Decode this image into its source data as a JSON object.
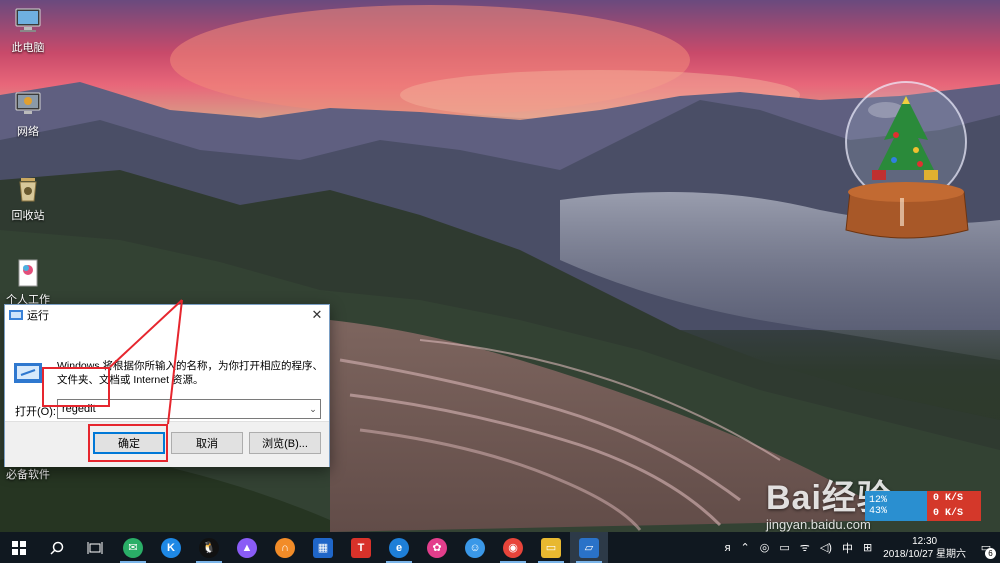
{
  "desktop": {
    "icons": [
      {
        "label": "此电脑"
      },
      {
        "label": "网络"
      },
      {
        "label": "回收站"
      },
      {
        "label": "个人工作"
      },
      {
        "label": "必备软件"
      }
    ]
  },
  "run_dialog": {
    "title": "运行",
    "description": "Windows 将根据你所输入的名称，为你打开相应的程序、文件夹、文档或 Internet 资源。",
    "open_label": "打开(O):",
    "open_value": "regedit",
    "ok_label": "确定",
    "cancel_label": "取消",
    "browse_label": "浏览(B)...",
    "close_glyph": "✕"
  },
  "watermark": {
    "brand": "Bai经验",
    "url": "jingyan.baidu.com"
  },
  "net_widget": {
    "cpu": "12%",
    "mem": "43%",
    "up": "0 K/S",
    "down": "0 K/S"
  },
  "taskbar": {
    "apps": [
      {
        "name": "wechat",
        "color": "#2aae67",
        "glyph": "✉"
      },
      {
        "name": "kugou",
        "color": "#1e88e5",
        "glyph": "K"
      },
      {
        "name": "qq",
        "color": "#111111",
        "glyph": "🐧"
      },
      {
        "name": "feishu-bird",
        "color": "#8a5cf6",
        "glyph": "▲"
      },
      {
        "name": "headphone",
        "color": "#f28c28",
        "glyph": "∩"
      },
      {
        "name": "office-ie",
        "color": "#1f66c9",
        "glyph": "▦"
      },
      {
        "name": "t-app",
        "color": "#d8322a",
        "glyph": "T"
      },
      {
        "name": "edge",
        "color": "#1e7fd8",
        "glyph": "e"
      },
      {
        "name": "photos",
        "color": "#e33e8c",
        "glyph": "✿"
      },
      {
        "name": "chat-blue",
        "color": "#3a98e8",
        "glyph": "☺"
      },
      {
        "name": "chrome",
        "color": "#e8443a",
        "glyph": "◉"
      },
      {
        "name": "explorer",
        "color": "#e8b830",
        "glyph": "▭"
      },
      {
        "name": "run",
        "color": "#2a72c8",
        "glyph": "▱"
      }
    ],
    "tray": {
      "ime": "中",
      "time": "12:30",
      "date": "2018/10/27 星期六",
      "notifications": "6"
    }
  },
  "colors": {
    "annotation": "#e6262e",
    "accent": "#0078d7"
  }
}
